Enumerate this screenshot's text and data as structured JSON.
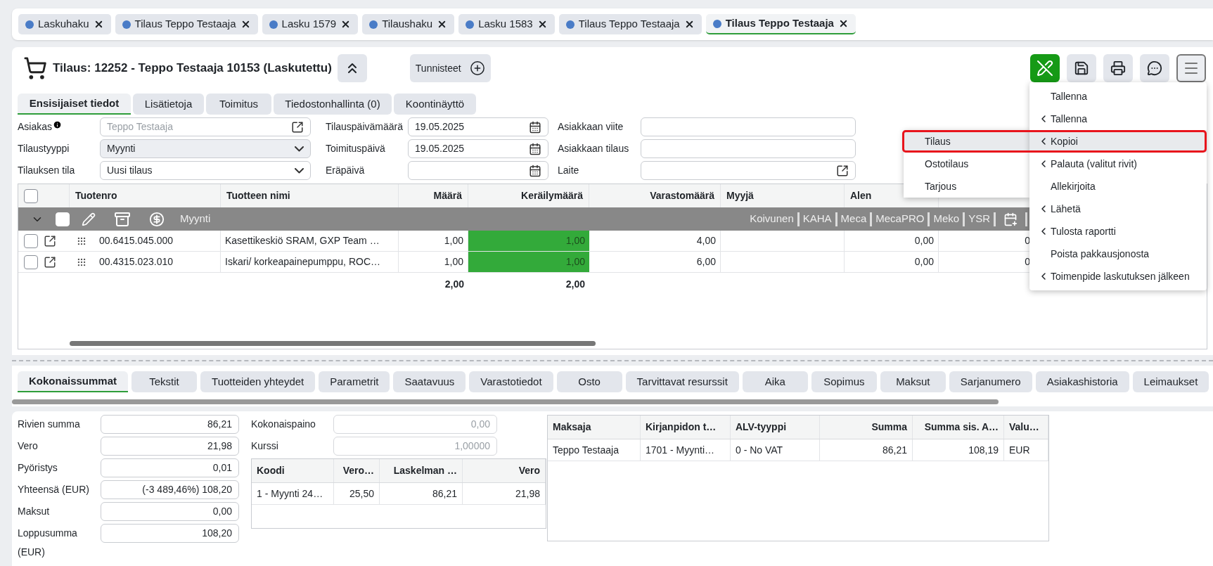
{
  "open_tabs": [
    {
      "label": "Laskuhaku",
      "selected": false
    },
    {
      "label": "Tilaus Teppo Testaaja",
      "selected": false
    },
    {
      "label": "Lasku 1579",
      "selected": false
    },
    {
      "label": "Tilaushaku",
      "selected": false
    },
    {
      "label": "Lasku 1583",
      "selected": false
    },
    {
      "label": "Tilaus Teppo Testaaja",
      "selected": false
    },
    {
      "label": "Tilaus Teppo Testaaja",
      "selected": true
    }
  ],
  "header": {
    "title": "Tilaus: 12252 - Teppo Testaaja 10153 (Laskutettu)",
    "tags_button": "Tunnisteet"
  },
  "form_tabs": [
    {
      "label": "Ensisijaiset tiedot",
      "selected": true
    },
    {
      "label": "Lisätietoja",
      "selected": false
    },
    {
      "label": "Toimitus",
      "selected": false
    },
    {
      "label": "Tiedostonhallinta (0)",
      "selected": false
    },
    {
      "label": "Koontinäyttö",
      "selected": false
    }
  ],
  "form_columns": [
    [
      {
        "label": "Asiakas",
        "info": true,
        "kind": "link",
        "placeholder": "Teppo Testaaja"
      },
      {
        "label": "Tilaustyyppi",
        "kind": "select",
        "value": "Myynti",
        "disabled": true
      },
      {
        "label": "Tilauksen tila",
        "kind": "select",
        "value": "Uusi tilaus",
        "disabled": false
      }
    ],
    [
      {
        "label": "Tilauspäivämäärä",
        "kind": "date",
        "value": "19.05.2025"
      },
      {
        "label": "Toimituspäivä",
        "kind": "date",
        "value": "19.05.2025"
      },
      {
        "label": "Eräpäivä",
        "kind": "date"
      }
    ],
    [
      {
        "label": "Asiakkaan viite",
        "kind": "text"
      },
      {
        "label": "Asiakkaan tilaus",
        "kind": "text"
      },
      {
        "label": "Laite",
        "kind": "link"
      }
    ]
  ],
  "grid": {
    "all_checked": false,
    "columns": [
      "Tuotenro",
      "Tuotteen nimi",
      "Määrä",
      "Keräilymäärä",
      "Varastomäärä",
      "Myyjä",
      "Alen"
    ],
    "group": {
      "label": "Myynti",
      "expanded": true,
      "checked": false,
      "sellers": [
        "Koivunen",
        "KAHA",
        "Meca",
        "MecaPRO",
        "Meko",
        "YSR"
      ]
    },
    "rows": [
      {
        "checked": false,
        "picked_complete": true,
        "product_no": "00.6415.045.000",
        "name": "Kasettikeskiö SRAM, GXP Team …",
        "quantity": "1,00",
        "picked": "1,00",
        "stock": "4,00",
        "discount": "0,00",
        "column_9": "0"
      },
      {
        "checked": false,
        "picked_complete": true,
        "product_no": "00.4315.023.010",
        "name": "Iskari/ korkeapainepumppu, ROC…",
        "quantity": "1,00",
        "picked": "1,00",
        "stock": "6,00",
        "discount": "0,00",
        "column_9": "0"
      }
    ],
    "totals": {
      "quantity": "2,00",
      "picked": "2,00"
    }
  },
  "menu": {
    "items": [
      {
        "label": "Tallenna",
        "submenu": false,
        "selected": false
      },
      {
        "label": "Tallenna",
        "submenu": true,
        "selected": false
      },
      {
        "label": "Kopioi",
        "submenu": true,
        "selected": true
      },
      {
        "label": "Palauta (valitut rivit)",
        "submenu": true,
        "selected": false
      },
      {
        "label": "Allekirjoita",
        "submenu": false,
        "selected": false
      },
      {
        "label": "Lähetä",
        "submenu": true,
        "selected": false
      },
      {
        "label": "Tulosta raportti",
        "submenu": true,
        "selected": false
      },
      {
        "label": "Poista pakkausjonosta",
        "submenu": false,
        "selected": false
      },
      {
        "label": "Toimenpide laskutuksen jälkeen",
        "submenu": true,
        "selected": false
      }
    ],
    "submenu": [
      {
        "label": "Tilaus",
        "selected": true
      },
      {
        "label": "Ostotilaus",
        "selected": false
      },
      {
        "label": "Tarjous",
        "selected": false
      }
    ]
  },
  "bottom_tabs": [
    {
      "label": "Kokonaissummat",
      "selected": true
    },
    {
      "label": "Tekstit",
      "selected": false
    },
    {
      "label": "Tuotteiden yhteydet",
      "selected": false
    },
    {
      "label": "Parametrit",
      "selected": false
    },
    {
      "label": "Saatavuus",
      "selected": false
    },
    {
      "label": "Varastotiedot",
      "selected": false
    },
    {
      "label": "Osto",
      "selected": false
    },
    {
      "label": "Tarvittavat resurssit",
      "selected": false
    },
    {
      "label": "Aika",
      "selected": false
    },
    {
      "label": "Sopimus",
      "selected": false
    },
    {
      "label": "Maksut",
      "selected": false
    },
    {
      "label": "Sarjanumero",
      "selected": false
    },
    {
      "label": "Asiakashistoria",
      "selected": false
    },
    {
      "label": "Leimaukset",
      "selected": false
    }
  ],
  "totals": [
    {
      "label": "Rivien summa",
      "value": "86,21"
    },
    {
      "label": "Vero",
      "value": "21,98"
    },
    {
      "label": "Pyöristys",
      "value": "0,01"
    },
    {
      "label": "Yhteensä (EUR)",
      "value": "(-3 489,46%) 108,20"
    },
    {
      "label": "Maksut",
      "value": "0,00"
    },
    {
      "label": "Loppusumma (EUR)",
      "value": "108,20"
    }
  ],
  "weights": [
    {
      "label": "Kokonaispaino",
      "value": "0,00",
      "disabled": true
    },
    {
      "label": "Kurssi",
      "value": "1,00000",
      "disabled": true
    }
  ],
  "tax_table": {
    "columns": [
      "Koodi",
      "Vero…",
      "Laskelman …",
      "Vero"
    ],
    "rows": [
      [
        "1 - Myynti 24…",
        "25,50",
        "86,21",
        "21,98"
      ]
    ]
  },
  "payer_table": {
    "columns": [
      "Maksaja",
      "Kirjanpidon t…",
      "ALV-tyyppi",
      "Summa",
      "Summa sis. A…",
      "Valu…"
    ],
    "rows": [
      [
        "Teppo Testaaja",
        "1701 - Myynti…",
        "0 - No VAT",
        "86,21",
        "108,19",
        "EUR"
      ]
    ]
  }
}
